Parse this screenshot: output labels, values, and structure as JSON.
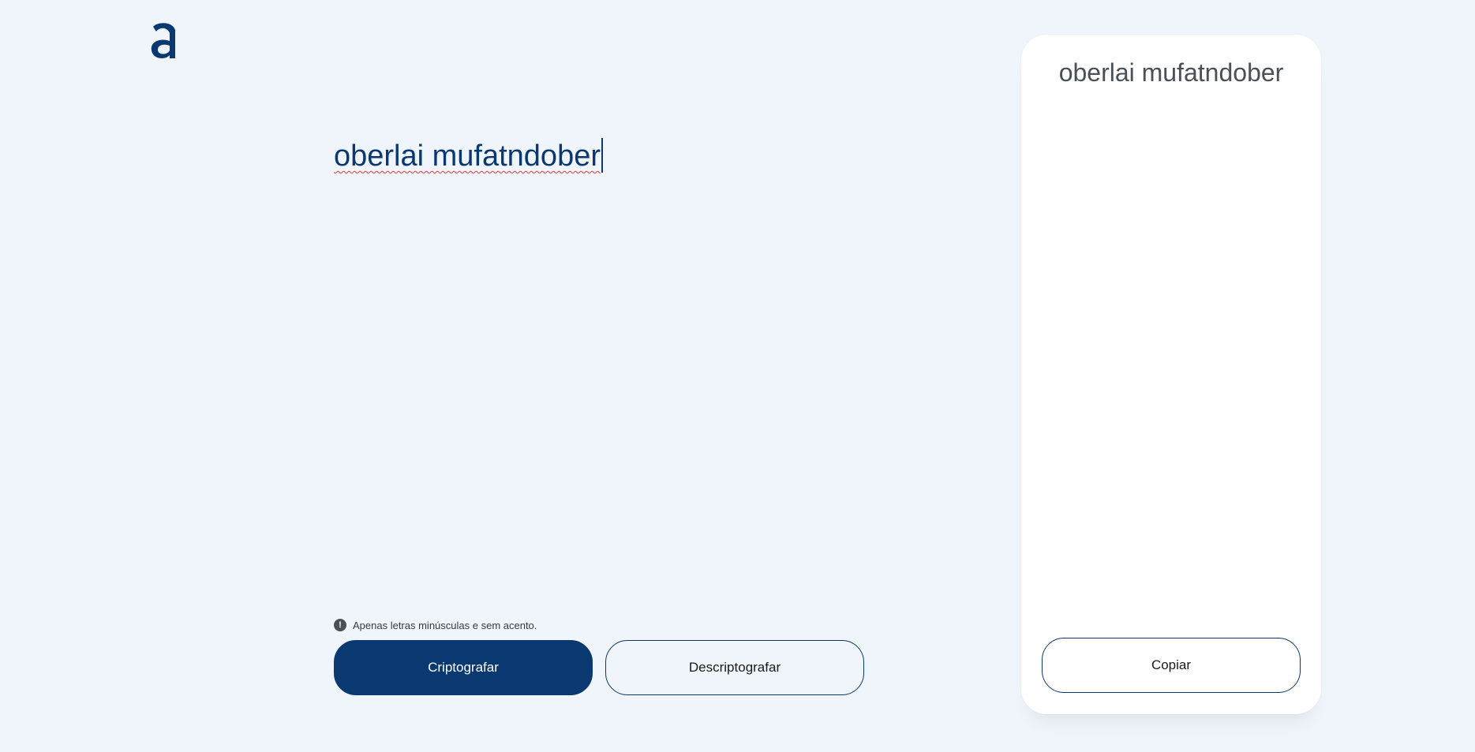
{
  "app": {
    "logo_icon": "alura-a-logo-icon",
    "accent_color": "#0a3871",
    "background_color": "#f0f5fc"
  },
  "editor": {
    "value": "oberlai mufatndober"
  },
  "hint": {
    "icon": "exclamation-circle-icon",
    "icon_glyph": "!",
    "text": "Apenas letras minúsculas e sem acento."
  },
  "actions": {
    "encrypt_label": "Criptografar",
    "decrypt_label": "Descriptografar"
  },
  "output_panel": {
    "result": "oberlai mufatndober",
    "copy_label": "Copiar"
  }
}
